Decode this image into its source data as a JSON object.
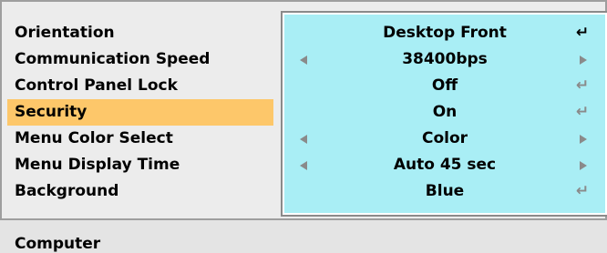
{
  "menu": {
    "rows": [
      {
        "label": "Orientation",
        "value": "Desktop Front",
        "control": "enter",
        "active": true
      },
      {
        "label": "Communication Speed",
        "value": "38400bps",
        "control": "arrows"
      },
      {
        "label": "Control Panel Lock",
        "value": "Off",
        "control": "enter"
      },
      {
        "label": "Security",
        "value": "On",
        "control": "enter",
        "selected": true
      },
      {
        "label": "Menu Color Select",
        "value": "Color",
        "control": "arrows"
      },
      {
        "label": "Menu Display Time",
        "value": "Auto 45 sec",
        "control": "arrows"
      },
      {
        "label": "Background",
        "value": "Blue",
        "control": "enter"
      }
    ],
    "icons": {
      "enter": "enter-return-icon",
      "left": "arrow-left-icon",
      "right": "arrow-right-icon"
    }
  },
  "status": {
    "source": "Computer"
  },
  "colors": {
    "highlight": "#fdc76a",
    "panel": "#a9eef5",
    "background": "#ececec"
  }
}
